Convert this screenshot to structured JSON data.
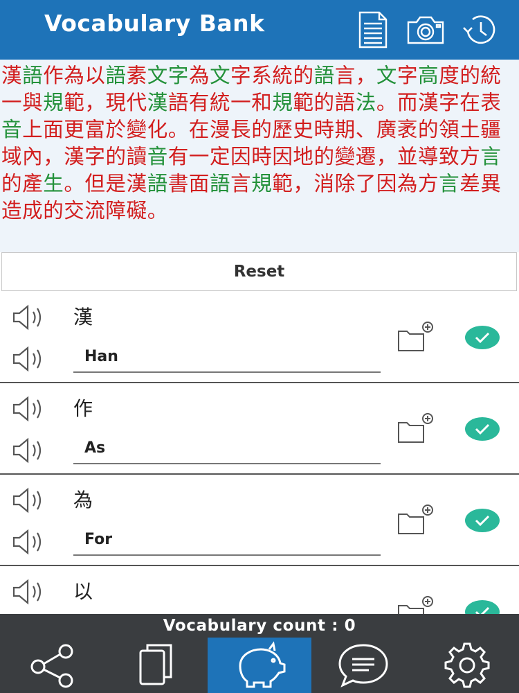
{
  "header": {
    "title": "Vocabulary Bank",
    "icons": [
      "document-icon",
      "camera-icon",
      "history-clock-icon"
    ]
  },
  "passage": {
    "segments": [
      {
        "text": "漢",
        "color": "red"
      },
      {
        "text": "語",
        "color": "green"
      },
      {
        "text": "作為以",
        "color": "red"
      },
      {
        "text": "語",
        "color": "green"
      },
      {
        "text": "素",
        "color": "red"
      },
      {
        "text": "文字",
        "color": "green"
      },
      {
        "text": "為",
        "color": "red"
      },
      {
        "text": "文",
        "color": "green"
      },
      {
        "text": "字系統的",
        "color": "red"
      },
      {
        "text": "語",
        "color": "green"
      },
      {
        "text": "言，",
        "color": "red"
      },
      {
        "text": "文",
        "color": "green"
      },
      {
        "text": "字",
        "color": "red"
      },
      {
        "text": "高",
        "color": "green"
      },
      {
        "text": "度的統一與",
        "color": "red"
      },
      {
        "text": "規",
        "color": "green"
      },
      {
        "text": "範，現代",
        "color": "red"
      },
      {
        "text": "漢",
        "color": "green"
      },
      {
        "text": "語有統一和",
        "color": "red"
      },
      {
        "text": "規",
        "color": "green"
      },
      {
        "text": "範的語",
        "color": "red"
      },
      {
        "text": "法",
        "color": "green"
      },
      {
        "text": "。而漢字在表",
        "color": "red"
      },
      {
        "text": "音",
        "color": "green"
      },
      {
        "text": "上面更富於變化。在漫長的歷史時期、廣袤的領土疆域內，漢字的讀",
        "color": "red"
      },
      {
        "text": "音",
        "color": "green"
      },
      {
        "text": "有一定因時因地的變遷，並導致方",
        "color": "red"
      },
      {
        "text": "言",
        "color": "green"
      },
      {
        "text": "的產",
        "color": "red"
      },
      {
        "text": "生",
        "color": "green"
      },
      {
        "text": "。但是漢",
        "color": "red"
      },
      {
        "text": "語",
        "color": "green"
      },
      {
        "text": "書面",
        "color": "red"
      },
      {
        "text": "語",
        "color": "green"
      },
      {
        "text": "言",
        "color": "red"
      },
      {
        "text": "規",
        "color": "green"
      },
      {
        "text": "範，消除了因為方",
        "color": "red"
      },
      {
        "text": "言",
        "color": "green"
      },
      {
        "text": "差異造成的交流障礙。",
        "color": "red"
      }
    ]
  },
  "reset_label": "Reset",
  "vocab": [
    {
      "word": "漢",
      "translation": "Han"
    },
    {
      "word": "作",
      "translation": "As"
    },
    {
      "word": "為",
      "translation": "For"
    },
    {
      "word": "以",
      "translation": ""
    }
  ],
  "count": {
    "text": "Vocabulary count : 0"
  },
  "nav": {
    "items": [
      "share-icon",
      "copy-icon",
      "piggy-bank-icon",
      "chat-icon",
      "settings-icon"
    ],
    "active_index": 2
  },
  "colors": {
    "header": "#1e73b8",
    "red_text": "#d21e1e",
    "green_text": "#23913a",
    "check": "#2ab89a",
    "nav_bg": "#3a3d40"
  }
}
